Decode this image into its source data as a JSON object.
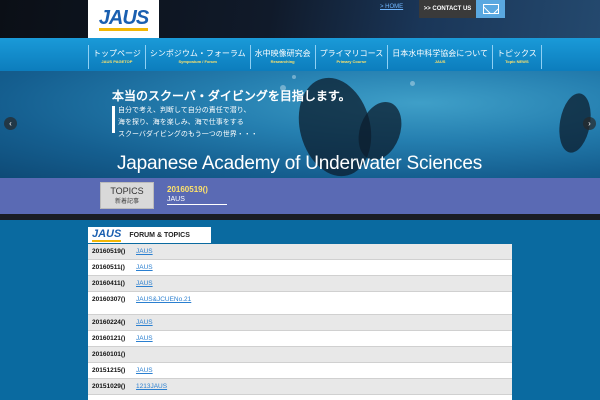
{
  "header": {
    "logo_text": "JAUS",
    "home_link": "> HOME",
    "contact_label": ">> CONTACT US"
  },
  "nav": [
    {
      "jp": "トップページ",
      "en": "JAUS PAGETOP"
    },
    {
      "jp": "シンポジウム・フォーラム",
      "en": "Symposium / Forum"
    },
    {
      "jp": "水中映像研究会",
      "en": "Researching"
    },
    {
      "jp": "プライマリコース",
      "en": "Primary Course"
    },
    {
      "jp": "日本水中科学協会について",
      "en": "JAUS"
    },
    {
      "jp": "トピックス",
      "en": "Topic NEWS"
    }
  ],
  "hero": {
    "title": "本当のスクーバ・ダイビングを目指します。",
    "lines": [
      "自分で考え、判断して自分の責任で潜り、",
      "海を探り、海を楽しみ、海で仕事をする",
      "スクーバダイビングのもう一つの世界・・・"
    ],
    "subtitle": "Japanese Academy of Underwater Sciences",
    "prev_arrow": "‹",
    "next_arrow": "›"
  },
  "topics": {
    "title": "TOPICS",
    "subtitle": "新着記事",
    "date": "20160519()",
    "link": "JAUS"
  },
  "forum": {
    "logo_text": "JAUS",
    "title": "FORUM & TOPICS",
    "rows": [
      {
        "date": "20160519()",
        "link": "JAUS"
      },
      {
        "date": "20160511()",
        "link": "JAUS"
      },
      {
        "date": "20160411()",
        "link": "JAUS"
      },
      {
        "date": "20160307()",
        "link": "JAUS&JCUENo.21"
      },
      {
        "date": "20160224()",
        "link": "JAUS"
      },
      {
        "date": "20160121()",
        "link": "JAUS"
      },
      {
        "date": "20160101()",
        "link": ""
      },
      {
        "date": "20151215()",
        "link": "JAUS"
      },
      {
        "date": "20151029()",
        "link": "1213JAUS"
      }
    ]
  }
}
